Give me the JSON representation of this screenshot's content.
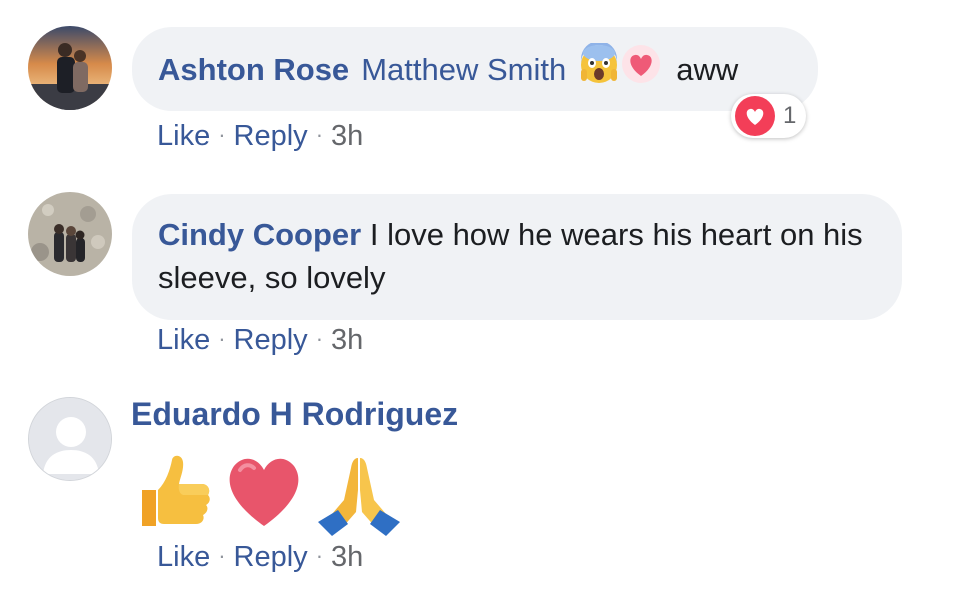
{
  "comments": [
    {
      "author": "Ashton Rose",
      "tag": "Matthew Smith",
      "text": "aww",
      "reaction_count": "1",
      "actions": {
        "like": "Like",
        "reply": "Reply",
        "time": "3h"
      }
    },
    {
      "author": "Cindy Cooper",
      "text": "I love how he wears his heart on his sleeve, so lovely",
      "actions": {
        "like": "Like",
        "reply": "Reply",
        "time": "3h"
      }
    },
    {
      "author": "Eduardo H Rodriguez",
      "emojis": [
        "thumbs-up-emoji",
        "heart-emoji",
        "praying-hands-emoji"
      ],
      "actions": {
        "like": "Like",
        "reply": "Reply",
        "time": "3h"
      }
    }
  ],
  "colors": {
    "link": "#385898",
    "bubble": "#f0f2f5",
    "love_reaction": "#f33e58"
  }
}
